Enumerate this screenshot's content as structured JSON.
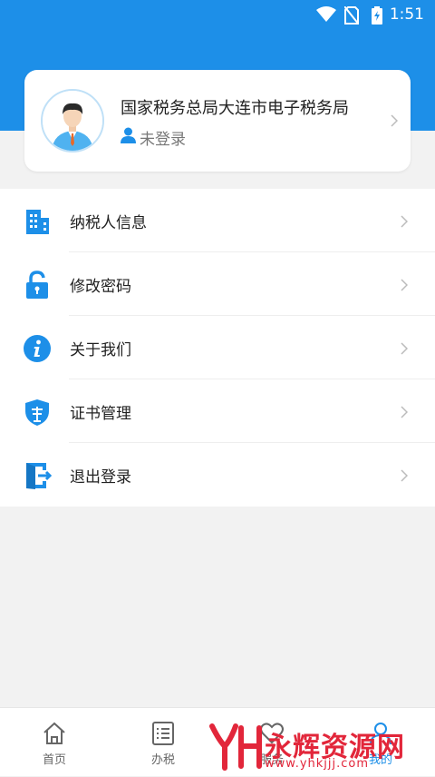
{
  "status_bar": {
    "time": "1:51"
  },
  "colors": {
    "primary": "#1d8fe8",
    "background": "#f2f2f2",
    "watermark": "#e2263a"
  },
  "profile": {
    "org_name": "国家税务总局大连市电子税务局",
    "login_status": "未登录",
    "avatar_icon": "user-avatar-icon",
    "login_icon": "user-icon"
  },
  "menu": {
    "items": [
      {
        "label": "纳税人信息",
        "icon": "building-icon"
      },
      {
        "label": "修改密码",
        "icon": "lock-icon"
      },
      {
        "label": "关于我们",
        "icon": "info-icon"
      },
      {
        "label": "证书管理",
        "icon": "shield-icon"
      },
      {
        "label": "退出登录",
        "icon": "logout-icon"
      }
    ]
  },
  "tabbar": {
    "tabs": [
      {
        "label": "首页",
        "icon": "home-icon",
        "active": false
      },
      {
        "label": "办税",
        "icon": "list-icon",
        "active": false
      },
      {
        "label": "服务",
        "icon": "heart-icon",
        "active": false
      },
      {
        "label": "我的",
        "icon": "person-icon",
        "active": true
      }
    ]
  },
  "watermark": {
    "text": "永辉资源网",
    "url": "www.yhkjjj.com"
  }
}
